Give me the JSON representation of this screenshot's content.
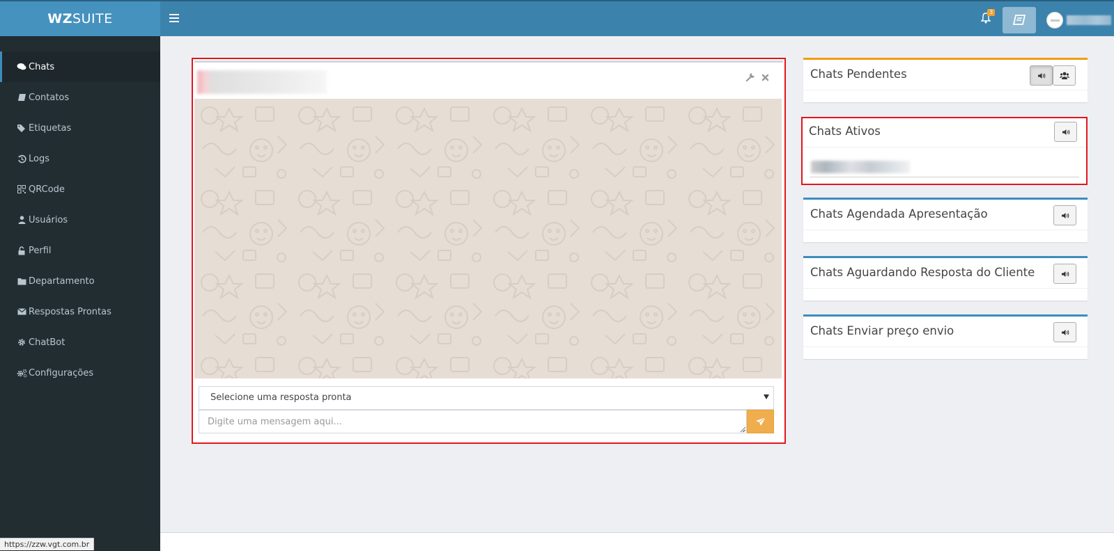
{
  "app": {
    "logo_bold": "WZ",
    "logo_rest": "SUITE",
    "notification_count": "3"
  },
  "sidebar": {
    "items": [
      {
        "label": "Chats",
        "icon": "comments-icon",
        "active": true
      },
      {
        "label": "Contatos",
        "icon": "book-icon",
        "active": false
      },
      {
        "label": "Etiquetas",
        "icon": "tags-icon",
        "active": false
      },
      {
        "label": "Logs",
        "icon": "history-icon",
        "active": false
      },
      {
        "label": "QRCode",
        "icon": "qrcode-icon",
        "active": false
      },
      {
        "label": "Usuários",
        "icon": "user-icon",
        "active": false
      },
      {
        "label": "Perfil",
        "icon": "unlock-icon",
        "active": false
      },
      {
        "label": "Departamento",
        "icon": "folder-icon",
        "active": false
      },
      {
        "label": "Respostas Prontas",
        "icon": "envelope-icon",
        "active": false
      },
      {
        "label": "ChatBot",
        "icon": "gear-icon",
        "active": false
      },
      {
        "label": "Configurações",
        "icon": "gears-icon",
        "active": false
      }
    ]
  },
  "chat": {
    "quick_reply_placeholder": "Selecione uma resposta pronta",
    "message_placeholder": "Digite uma mensagem aqui..."
  },
  "panels": {
    "pendentes": {
      "title": "Chats Pendentes",
      "accent": "#f39c12"
    },
    "ativos": {
      "title": "Chats Ativos"
    },
    "agendada": {
      "title": "Chats Agendada Apresentação",
      "accent": "#3c8dbc"
    },
    "aguardando": {
      "title": "Chats Aguardando Resposta do Cliente",
      "accent": "#3c8dbc"
    },
    "enviar_preco": {
      "title": "Chats Enviar preço envio",
      "accent": "#3c8dbc"
    }
  },
  "status_bar": {
    "url": "https://zzw.vgt.com.br"
  },
  "colors": {
    "topbar": "#3b83ac",
    "logo_bg": "#4592bf",
    "sidebar": "#222d32",
    "highlight": "#e2161d",
    "send_button": "#f0ad4e",
    "chat_bg": "#e6ddd5"
  }
}
